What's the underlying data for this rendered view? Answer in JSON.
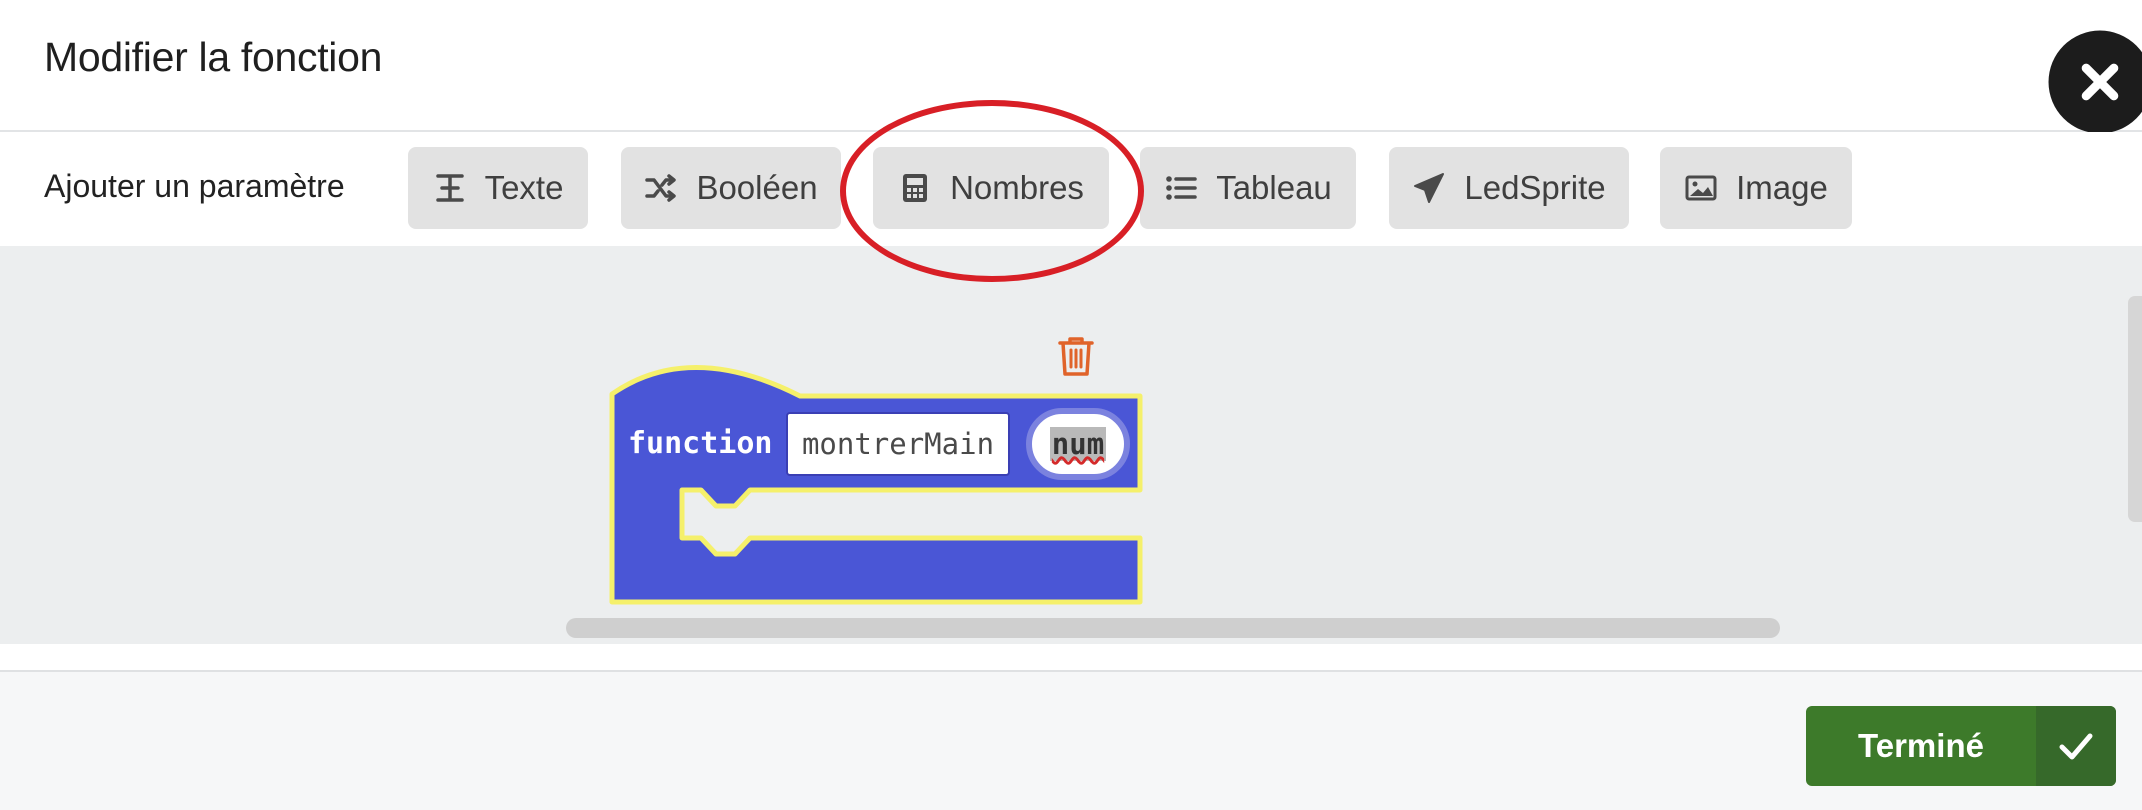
{
  "header": {
    "title": "Modifier la fonction",
    "close_icon": "close-icon"
  },
  "params": {
    "label": "Ajouter un paramètre",
    "buttons": [
      {
        "label": "Texte",
        "icon": "text-icon"
      },
      {
        "label": "Booléen",
        "icon": "shuffle-icon"
      },
      {
        "label": "Nombres",
        "icon": "calculator-icon"
      },
      {
        "label": "Tableau",
        "icon": "list-icon"
      },
      {
        "label": "LedSprite",
        "icon": "paper-plane-icon"
      },
      {
        "label": "Image",
        "icon": "image-icon"
      }
    ]
  },
  "workspace": {
    "block": {
      "keyword": "function",
      "name": "montrerMain",
      "param": "num",
      "color": "#4a56d6",
      "highlight": "#f5f06b"
    },
    "trash_icon": "trash-icon"
  },
  "footer": {
    "done_label": "Terminé",
    "done_icon": "check-icon"
  },
  "colors": {
    "accent_green": "#3d7a2a",
    "annotation_red": "#d81f26",
    "button_gray": "#e2e2e2"
  }
}
